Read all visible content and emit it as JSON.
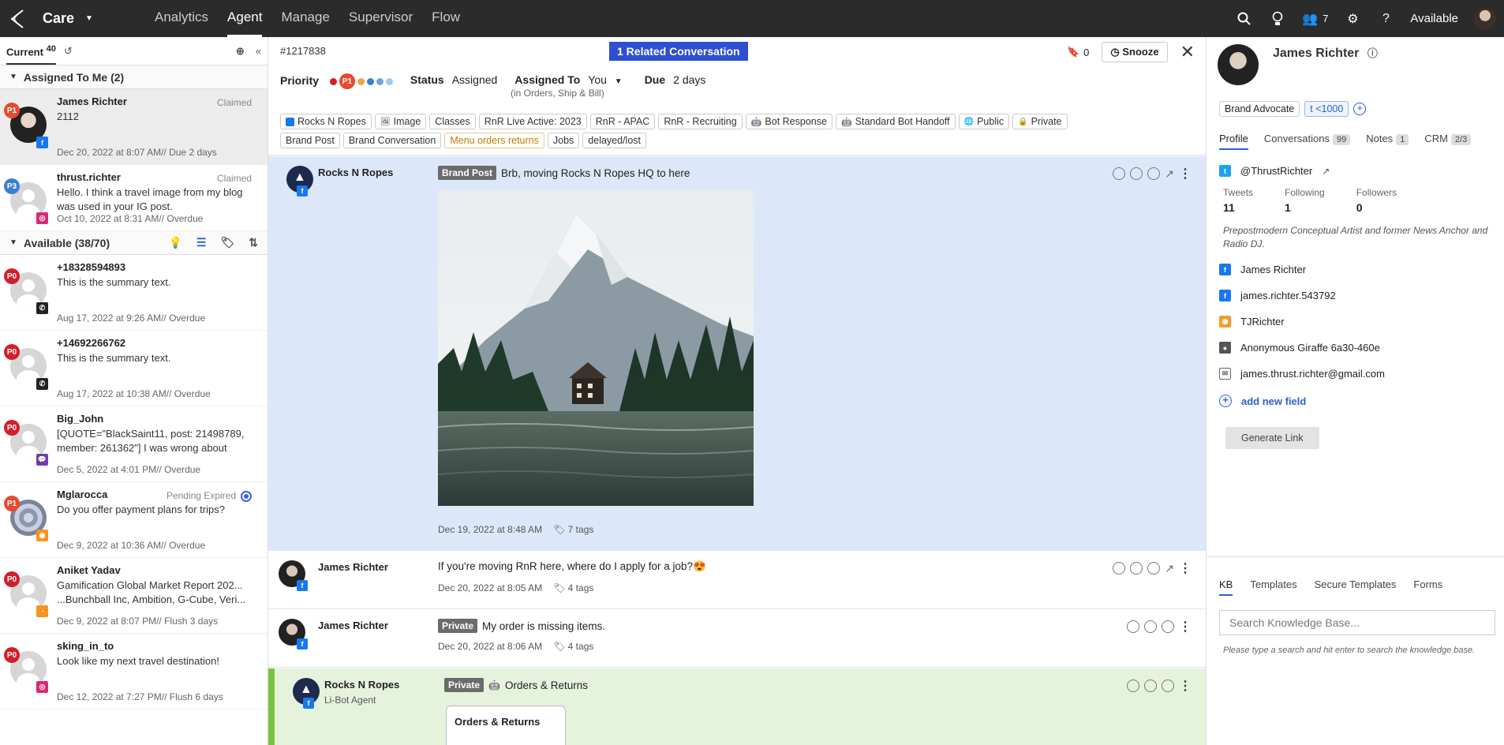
{
  "topbar": {
    "app_name": "Care",
    "nav": [
      "Analytics",
      "Agent",
      "Manage",
      "Supervisor",
      "Flow"
    ],
    "active_nav": "Agent",
    "team_count": "7",
    "status": "Available"
  },
  "left": {
    "current_label": "Current",
    "current_count": "40",
    "assigned_header": "Assigned To Me (2)",
    "available_header": "Available (38/70)",
    "assigned": [
      {
        "priority": "P1",
        "name": "James Richter",
        "status": "Claimed",
        "text": "2112",
        "meta": "Dec 20, 2022 at 8:07 AM//  Due 2 days"
      },
      {
        "priority": "P3",
        "name": "thrust.richter",
        "status": "Claimed",
        "text": "Hello. I think a travel image from my blog was used in your IG post.",
        "meta": "Oct 10, 2022 at 8:31 AM//  Overdue"
      }
    ],
    "available": [
      {
        "priority": "P0",
        "name": "+18328594893",
        "status": "",
        "text": "This is the summary text.",
        "meta": "Aug 17, 2022 at 9:26 AM//  Overdue"
      },
      {
        "priority": "P0",
        "name": "+14692266762",
        "status": "",
        "text": "This is the summary text.",
        "meta": "Aug 17, 2022 at 10:38 AM//  Overdue"
      },
      {
        "priority": "P0",
        "name": "Big_John",
        "status": "",
        "text": "[QUOTE=\"BlackSaint11, post: 21498789, member: 261362\"] I was wrong about",
        "meta": "Dec 5, 2022 at 4:01 PM//  Overdue"
      },
      {
        "priority": "P1",
        "name": "Mglarocca",
        "status": "Pending Expired",
        "text": "Do you offer payment plans for trips?",
        "meta": "Dec 9, 2022 at 10:36 AM//  Overdue"
      },
      {
        "priority": "P0",
        "name": "Aniket Yadav",
        "status": "",
        "text": "Gamification Global Market Report 202... ...Bunchball Inc, Ambition, G-Cube, Veri...",
        "meta": "Dec 9, 2022 at 8:07 PM//  Flush 3 days"
      },
      {
        "priority": "P0",
        "name": "sking_in_to",
        "status": "",
        "text": "Look like my next travel destination!",
        "meta": "Dec 12, 2022 at 7:27 PM//  Flush 6 days"
      }
    ]
  },
  "center": {
    "ticket_id": "#1217838",
    "related": "1 Related Conversation",
    "bookmark_count": "0",
    "snooze": "Snooze",
    "priority_label": "Priority",
    "priority_value": "P1",
    "status_label": "Status",
    "status_value": "Assigned",
    "assigned_label": "Assigned To",
    "assigned_value": "You",
    "assigned_sub": "(in Orders, Ship & Bill)",
    "due_label": "Due",
    "due_value": "2 days",
    "tags": [
      "Rocks N Ropes",
      "Image",
      "Classes",
      "RnR Live Active: 2023",
      "RnR - APAC",
      "RnR - Recruiting",
      "Bot Response",
      "Standard Bot Handoff",
      "Public",
      "Private",
      "Brand Post",
      "Brand Conversation",
      "Menu orders returns",
      "Jobs",
      "delayed/lost"
    ],
    "messages": [
      {
        "author": "Rocks N Ropes",
        "label": "Brand Post",
        "text": "Brb, moving Rocks N Ropes HQ to here",
        "time": "Dec 19, 2022 at 8:48 AM",
        "tags": "7 tags"
      },
      {
        "author": "James Richter",
        "text": "If you're moving RnR here, where do I apply for a job?😍",
        "time": "Dec 20, 2022 at 8:05 AM",
        "tags": "4 tags"
      },
      {
        "author": "James Richter",
        "label": "Private",
        "text": "My order is missing items.",
        "time": "Dec 20, 2022 at 8:06 AM",
        "tags": "4 tags"
      },
      {
        "author": "Rocks N Ropes",
        "sub": "Li-Bot Agent",
        "label": "Private",
        "text": "Orders & Returns",
        "card": "Orders & Returns"
      }
    ]
  },
  "right": {
    "name": "James Richter",
    "badges": [
      "Brand Advocate",
      "t <1000"
    ],
    "tabs": [
      {
        "label": "Profile",
        "count": ""
      },
      {
        "label": "Conversations",
        "count": "99"
      },
      {
        "label": "Notes",
        "count": "1"
      },
      {
        "label": "CRM",
        "count": "2/3"
      }
    ],
    "handle": "@ThrustRichter",
    "stats": [
      {
        "label": "Tweets",
        "value": "11"
      },
      {
        "label": "Following",
        "value": "1"
      },
      {
        "label": "Followers",
        "value": "0"
      }
    ],
    "bio": "Prepostmodern Conceptual Artist and former News Anchor and Radio DJ.",
    "fields": [
      "James Richter",
      "james.richter.543792",
      "TJRichter",
      "Anonymous Giraffe 6a30-460e",
      "james.thrust.richter@gmail.com"
    ],
    "add_field": "add new field",
    "generate_link": "Generate Link",
    "kb_tabs": [
      "KB",
      "Templates",
      "Secure Templates",
      "Forms"
    ],
    "kb_placeholder": "Search Knowledge Base...",
    "kb_hint": "Please type a search and hit enter to search the knowledge base."
  },
  "colors": {
    "accent": "#2d4fd0",
    "brand_post_bg": "#dce8fa",
    "bot_bg": "#e6f3dc"
  }
}
